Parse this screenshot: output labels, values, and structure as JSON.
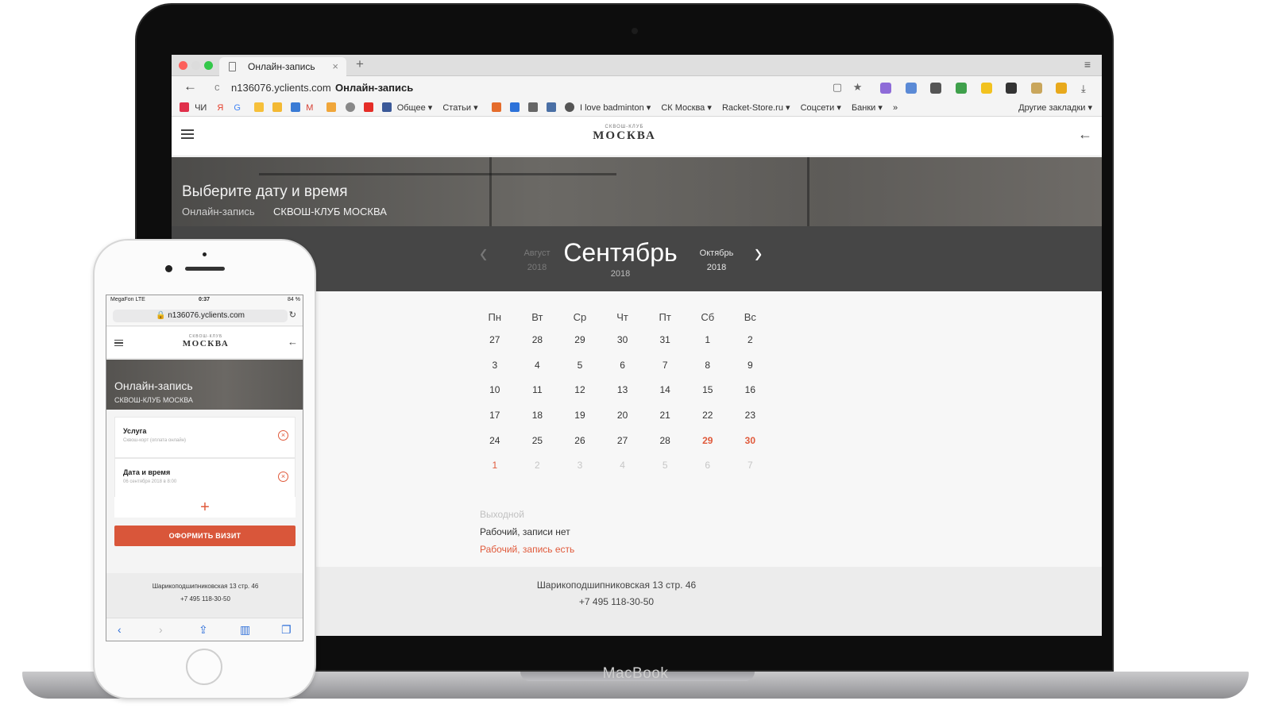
{
  "device": {
    "laptop_label": "MacBook"
  },
  "browser": {
    "tab_title": "Онлайн-запись",
    "tab_close": "×",
    "new_tab": "+",
    "menu": "≡",
    "back": "←",
    "reload": "c",
    "url": "n136076.yclients.com",
    "page_title": "Онлайн-запись",
    "addr_icons": "▢ ★",
    "bookmarks": {
      "first_label": "ЧИ",
      "y_label": "Я",
      "g_label": "G",
      "gmail_label": "M",
      "items": [
        "Общее ▾",
        "Статьи ▾"
      ],
      "items2": [
        "I love badminton ▾",
        "СК Москва ▾",
        "Racket-Store.ru ▾",
        "Соцсети ▾",
        "Банки ▾",
        "»"
      ],
      "other": "Другие закладки ▾"
    }
  },
  "site": {
    "logo_small": "СКВОШ-КЛУБ",
    "logo_main": "МОСКВА",
    "header_back": "←",
    "hero_title": "Выберите дату и время",
    "crumb_online": "Онлайн-запись",
    "crumb_club": "СКВОШ-КЛУБ МОСКВА",
    "month_prev": "Август",
    "month_prev_year": "2018",
    "month_current": "Сентябрь",
    "month_current_year": "2018",
    "month_next": "Октябрь",
    "month_next_year": "2018",
    "prev_arrow": "‹",
    "next_arrow": "›",
    "weekdays": [
      "Пн",
      "Вт",
      "Ср",
      "Чт",
      "Пт",
      "Сб",
      "Вс"
    ],
    "days": [
      {
        "d": "27",
        "s": "normal"
      },
      {
        "d": "28",
        "s": "normal"
      },
      {
        "d": "29",
        "s": "normal"
      },
      {
        "d": "30",
        "s": "normal"
      },
      {
        "d": "31",
        "s": "normal"
      },
      {
        "d": "1",
        "s": "normal"
      },
      {
        "d": "2",
        "s": "normal"
      },
      {
        "d": "3",
        "s": "normal"
      },
      {
        "d": "4",
        "s": "normal"
      },
      {
        "d": "5",
        "s": "normal"
      },
      {
        "d": "6",
        "s": "normal"
      },
      {
        "d": "7",
        "s": "normal"
      },
      {
        "d": "8",
        "s": "normal"
      },
      {
        "d": "9",
        "s": "normal"
      },
      {
        "d": "10",
        "s": "normal"
      },
      {
        "d": "11",
        "s": "normal"
      },
      {
        "d": "12",
        "s": "normal"
      },
      {
        "d": "13",
        "s": "normal"
      },
      {
        "d": "14",
        "s": "normal"
      },
      {
        "d": "15",
        "s": "normal"
      },
      {
        "d": "16",
        "s": "normal"
      },
      {
        "d": "17",
        "s": "normal"
      },
      {
        "d": "18",
        "s": "normal"
      },
      {
        "d": "19",
        "s": "normal"
      },
      {
        "d": "20",
        "s": "normal"
      },
      {
        "d": "21",
        "s": "normal"
      },
      {
        "d": "22",
        "s": "normal"
      },
      {
        "d": "23",
        "s": "normal"
      },
      {
        "d": "24",
        "s": "normal"
      },
      {
        "d": "25",
        "s": "normal"
      },
      {
        "d": "26",
        "s": "normal"
      },
      {
        "d": "27",
        "s": "normal"
      },
      {
        "d": "28",
        "s": "normal"
      },
      {
        "d": "29",
        "s": "booked"
      },
      {
        "d": "30",
        "s": "booked"
      },
      {
        "d": "1",
        "s": "booked-normal"
      },
      {
        "d": "2",
        "s": "muted"
      },
      {
        "d": "3",
        "s": "muted"
      },
      {
        "d": "4",
        "s": "muted"
      },
      {
        "d": "5",
        "s": "muted"
      },
      {
        "d": "6",
        "s": "muted"
      },
      {
        "d": "7",
        "s": "muted"
      }
    ],
    "legend": {
      "day_off": "Выходной",
      "working_no_records": "Рабочий, записи нет",
      "working_has_records": "Рабочий, запись есть"
    },
    "footer_address": "Шарикоподшипниковская 13 стр. 46",
    "footer_phone": "+7 495 118-30-50"
  },
  "phone": {
    "carrier": "MegaFon  LTE",
    "time": "0:37",
    "battery": "84 %",
    "url": "🔒 n136076.yclients.com",
    "reload": "↻",
    "back": "←",
    "hero_title": "Онлайн-запись",
    "hero_sub": "СКВОШ-КЛУБ МОСКВА",
    "service_title": "Услуга",
    "service_sub": "Сквош-корт (оплата онлайн)",
    "datetime_title": "Дата и время",
    "datetime_sub": "06 сентября 2018 в 8:00",
    "remove": "×",
    "add": "+",
    "submit": "ОФОРМИТЬ ВИЗИТ",
    "footer_address": "Шарикоподшипниковская 13 стр. 46",
    "footer_phone": "+7 495 118-30-50",
    "toolbar": {
      "back": "‹",
      "forward": "›",
      "share": "⇪",
      "bookmarks": "▥",
      "tabs": "❐"
    }
  },
  "colors": {
    "accent": "#e05a3b",
    "month_bar": "#464646",
    "footer": "#ececec"
  }
}
